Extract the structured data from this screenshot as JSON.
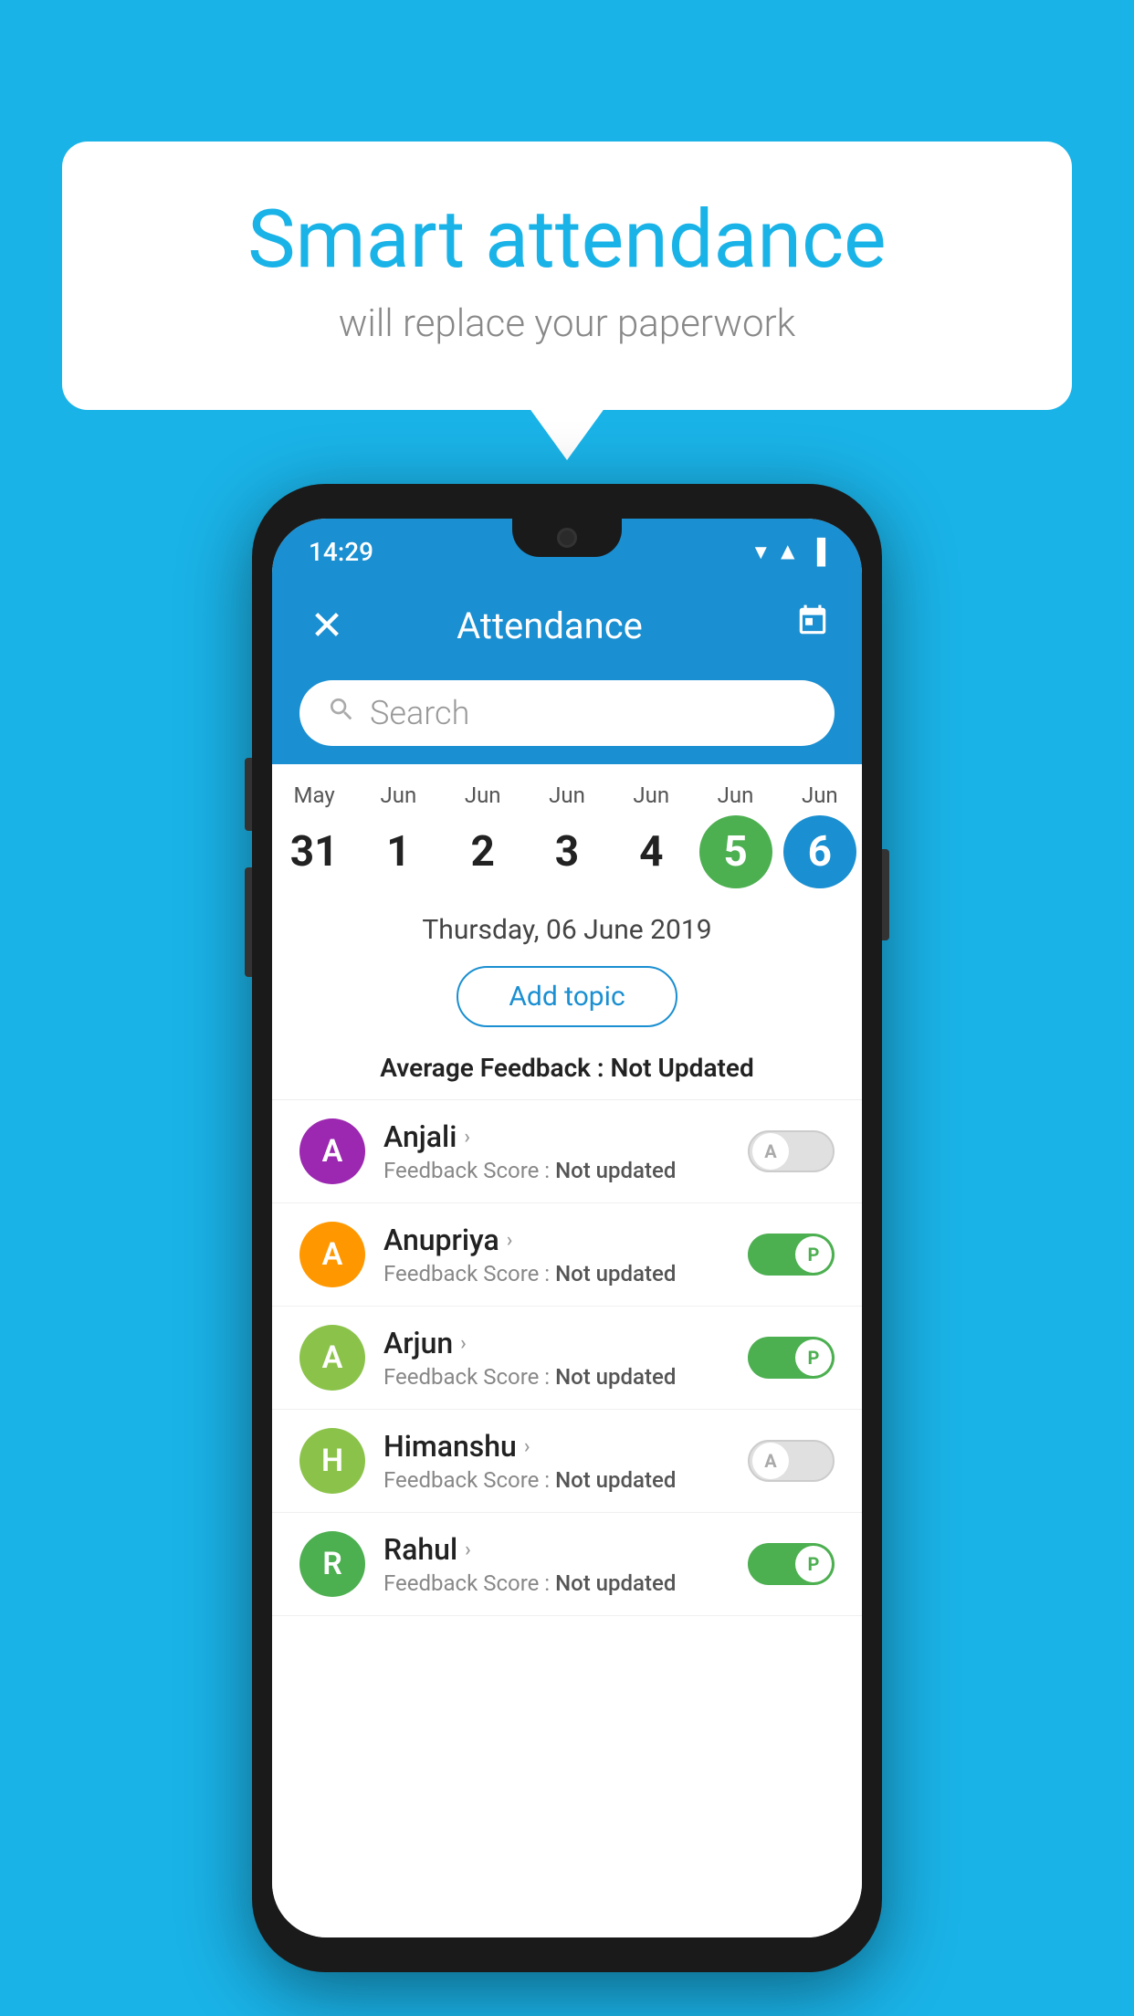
{
  "background_color": "#1ab3e8",
  "bubble": {
    "title": "Smart attendance",
    "subtitle": "will replace your paperwork"
  },
  "phone": {
    "status_bar": {
      "time": "14:29",
      "icons": "▼◀▐"
    },
    "app_bar": {
      "close_label": "✕",
      "title": "Attendance",
      "calendar_icon": "📅"
    },
    "search": {
      "placeholder": "Search"
    },
    "calendar": {
      "days": [
        {
          "month": "May",
          "date": "31",
          "state": "normal"
        },
        {
          "month": "Jun",
          "date": "1",
          "state": "normal"
        },
        {
          "month": "Jun",
          "date": "2",
          "state": "normal"
        },
        {
          "month": "Jun",
          "date": "3",
          "state": "normal"
        },
        {
          "month": "Jun",
          "date": "4",
          "state": "normal"
        },
        {
          "month": "Jun",
          "date": "5",
          "state": "today"
        },
        {
          "month": "Jun",
          "date": "6",
          "state": "selected"
        }
      ]
    },
    "selected_date": "Thursday, 06 June 2019",
    "add_topic_label": "Add topic",
    "average_feedback": {
      "label": "Average Feedback : ",
      "value": "Not Updated"
    },
    "students": [
      {
        "name": "Anjali",
        "avatar_letter": "A",
        "avatar_color": "#9c27b0",
        "feedback_label": "Feedback Score : ",
        "feedback_value": "Not updated",
        "attendance": "absent",
        "toggle_label": "A"
      },
      {
        "name": "Anupriya",
        "avatar_letter": "A",
        "avatar_color": "#ff9800",
        "feedback_label": "Feedback Score : ",
        "feedback_value": "Not updated",
        "attendance": "present",
        "toggle_label": "P"
      },
      {
        "name": "Arjun",
        "avatar_letter": "A",
        "avatar_color": "#8bc34a",
        "feedback_label": "Feedback Score : ",
        "feedback_value": "Not updated",
        "attendance": "present",
        "toggle_label": "P"
      },
      {
        "name": "Himanshu",
        "avatar_letter": "H",
        "avatar_color": "#8bc34a",
        "feedback_label": "Feedback Score : ",
        "feedback_value": "Not updated",
        "attendance": "absent",
        "toggle_label": "A"
      },
      {
        "name": "Rahul",
        "avatar_letter": "R",
        "avatar_color": "#4caf50",
        "feedback_label": "Feedback Score : ",
        "feedback_value": "Not updated",
        "attendance": "present",
        "toggle_label": "P"
      }
    ]
  }
}
